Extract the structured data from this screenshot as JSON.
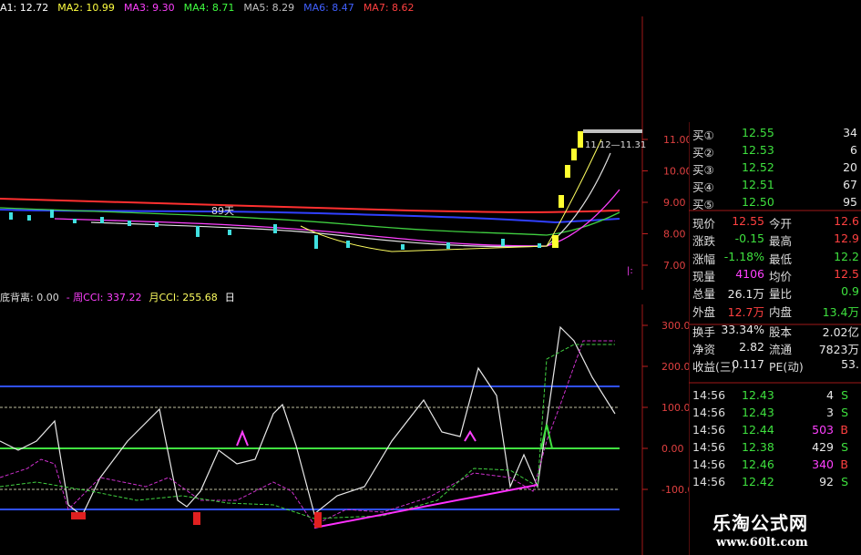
{
  "ma_bar": [
    {
      "text": "A1: 12.72",
      "color": "#ffffff"
    },
    {
      "text": "MA2: 10.99",
      "color": "#ffff40"
    },
    {
      "text": "MA3: 9.30",
      "color": "#ff40ff"
    },
    {
      "text": "MA4: 8.71",
      "color": "#40ff40"
    },
    {
      "text": "MA5: 8.29",
      "color": "#c0c0c0"
    },
    {
      "text": "MA6: 8.47",
      "color": "#4060ff"
    },
    {
      "text": "MA7: 8.62",
      "color": "#ff4040"
    }
  ],
  "price_axis": [
    "11.00",
    "10.00",
    "9.00",
    "8.00",
    "7.00"
  ],
  "price_annotations": {
    "label_days": "89天",
    "high_label": "11.12—11.31"
  },
  "cci_bar": [
    {
      "text": "底背离: 0.00",
      "color": "#dddddd"
    },
    {
      "text": "- 周CCI: 337.22",
      "color": "#ff40ff"
    },
    {
      "text": "月CCI: 255.68",
      "color": "#ffff60"
    },
    {
      "text": "日",
      "color": "#ffffff"
    }
  ],
  "cci_axis": [
    "300.0",
    "200.0",
    "100.0",
    "0.00",
    "-100.0"
  ],
  "bid_rows": [
    {
      "label": "买①",
      "price": "12.55",
      "vol": "34"
    },
    {
      "label": "买②",
      "price": "12.53",
      "vol": "6"
    },
    {
      "label": "买③",
      "price": "12.52",
      "vol": "20"
    },
    {
      "label": "买④",
      "price": "12.51",
      "vol": "67"
    },
    {
      "label": "买⑤",
      "price": "12.50",
      "vol": "95"
    }
  ],
  "stats": [
    {
      "l1": "现价",
      "v1": "12.55",
      "c1": "up",
      "l2": "今开",
      "v2": "12.6",
      "c2": "up"
    },
    {
      "l1": "涨跌",
      "v1": "-0.15",
      "c1": "dn",
      "l2": "最高",
      "v2": "12.9",
      "c2": "up"
    },
    {
      "l1": "涨幅",
      "v1": "-1.18%",
      "c1": "dn",
      "l2": "最低",
      "v2": "12.2",
      "c2": "dn"
    },
    {
      "l1": "现量",
      "v1": "4106",
      "c1": "mag",
      "l2": "均价",
      "v2": "12.5",
      "c2": "up"
    },
    {
      "l1": "总量",
      "v1": "26.1万",
      "c1": "yel",
      "l2": "量比",
      "v2": "0.9",
      "c2": "dn"
    },
    {
      "l1": "外盘",
      "v1": "12.7万",
      "c1": "up",
      "l2": "内盘",
      "v2": "13.4万",
      "c2": "dn"
    },
    {
      "l1": "换手",
      "v1": "33.34%",
      "c1": "yel",
      "l2": "股本",
      "v2": "2.02亿",
      "c2": "yel"
    },
    {
      "l1": "净资",
      "v1": "2.82",
      "c1": "yel",
      "l2": "流通",
      "v2": "7823万",
      "c2": "yel"
    },
    {
      "l1": "收益(三)",
      "v1": "0.117",
      "c1": "yel",
      "l2": "PE(动)",
      "v2": "53.",
      "c2": "yel"
    }
  ],
  "ticks": [
    {
      "time": "14:56",
      "price": "12.43",
      "vol": "4",
      "side": "S"
    },
    {
      "time": "14:56",
      "price": "12.43",
      "vol": "3",
      "side": "S"
    },
    {
      "time": "14:56",
      "price": "12.44",
      "vol": "503",
      "side": "B"
    },
    {
      "time": "14:56",
      "price": "12.38",
      "vol": "429",
      "side": "S"
    },
    {
      "time": "14:56",
      "price": "12.46",
      "vol": "340",
      "side": "B"
    },
    {
      "time": "14:56",
      "price": "12.42",
      "vol": "92",
      "side": "S"
    }
  ],
  "footer": {
    "title": "乐淘公式网",
    "url": "www.60lt.com"
  },
  "colors": {
    "up": "#ff4040",
    "down": "#3ee03e",
    "axis_red": "#c02020"
  }
}
